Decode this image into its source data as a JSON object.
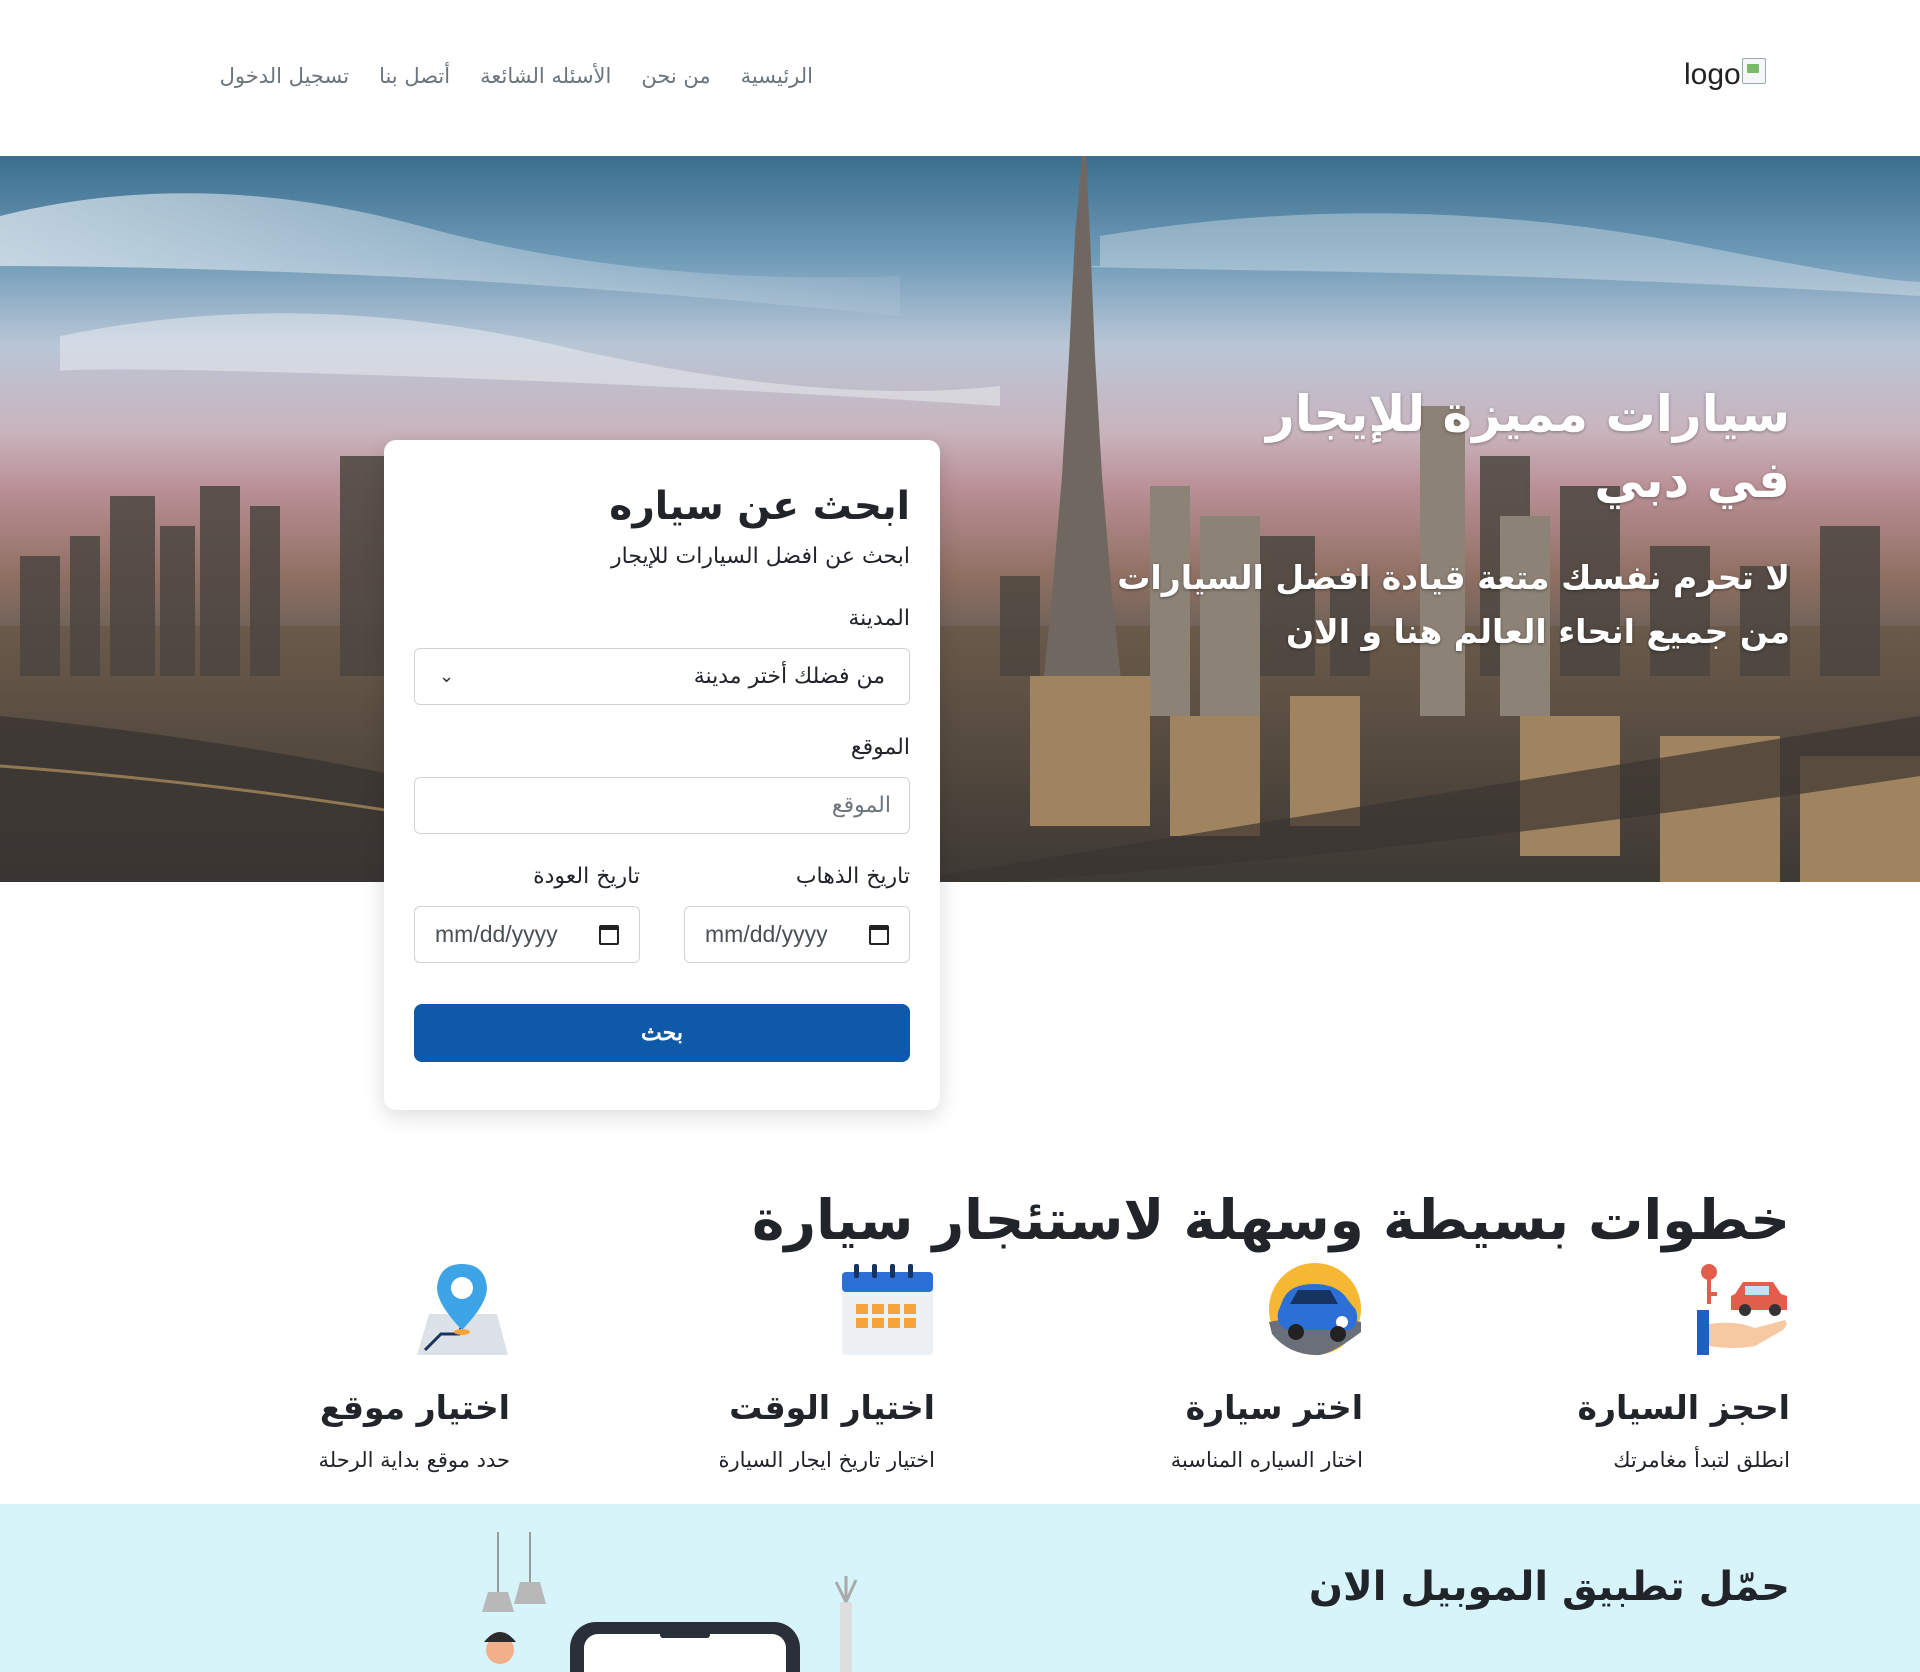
{
  "navbar": {
    "logo_alt": "logo",
    "links": [
      "الرئيسية",
      "من نحن",
      "الأسئله الشائعة",
      "أتصل بنا",
      "تسجيل الدخول"
    ]
  },
  "hero": {
    "title": "سيارات مميزة للإيجار في دبي",
    "subtitle": "لا تحرم نفسك متعة قيادة افضل السيارات من جميع انحاء العالم هنا و الان"
  },
  "search": {
    "title": "ابحث عن سياره",
    "subtitle": "ابحث عن افضل السيارات للإيجار",
    "city_label": "المدينة",
    "city_value": "من فضلك أختر مدينة",
    "location_label": "الموقع",
    "location_placeholder": "الموقع",
    "depart_label": "تاريخ الذهاب",
    "return_label": "تاريخ العودة",
    "depart_value": "mm/dd/yyyy",
    "return_value": "mm/dd/yyyy",
    "submit_label": "بحث"
  },
  "steps": {
    "title": "خطوات بسيطة وسهلة لاستئجار سيارة",
    "items": [
      {
        "icon": "car-key-hand-icon",
        "title": "احجز السيارة",
        "desc": "انطلق لتبدأ مغامرتك"
      },
      {
        "icon": "blue-car-icon",
        "title": "اختر سيارة",
        "desc": "اختار السياره المناسبة"
      },
      {
        "icon": "calendar-icon",
        "title": "اختيار الوقت",
        "desc": "اختيار تاريخ ايجار السيارة"
      },
      {
        "icon": "map-pin-icon",
        "title": "اختيار موقع",
        "desc": "حدد موقع بداية الرحلة"
      }
    ]
  },
  "app_section": {
    "title": "حمّل تطبيق الموبيل الان"
  },
  "colors": {
    "primary_button": "#0f5aa8",
    "app_section_bg": "#d8f4fb"
  }
}
